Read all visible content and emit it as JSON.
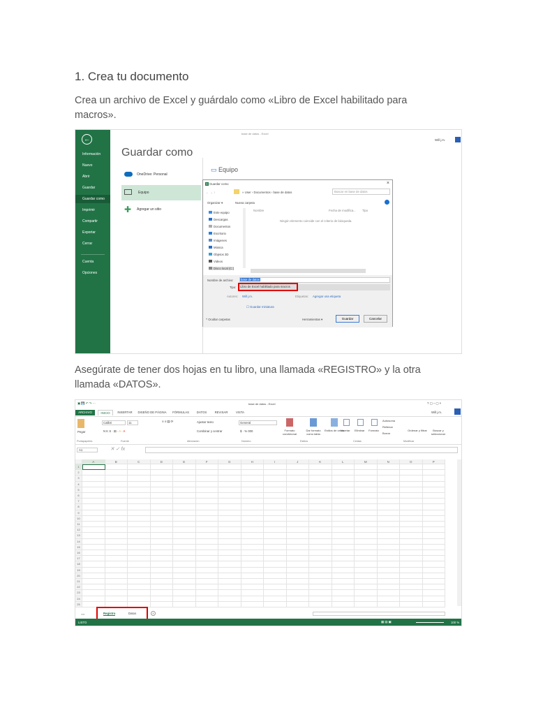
{
  "heading": "1. Crea tu documento",
  "para1": "Crea un archivo de Excel y guárdalo como «Libro de Excel habilitado para macros».",
  "para2": "Asegúrate de tener dos hojas en tu libro, una llamada «REGISTRO» y la otra llamada «DATOS».",
  "shot1": {
    "window_title": "base de datos - Excel",
    "user": "Will j.m.",
    "sidebar": [
      "Información",
      "Nuevo",
      "Abrir",
      "Guardar",
      "Guardar como",
      "Imprimir",
      "Compartir",
      "Exportar",
      "Cerrar",
      "Cuenta",
      "Opciones"
    ],
    "title": "Guardar como",
    "locations": [
      "OneDrive: Personal",
      "Equipo",
      "Agregar un sitio"
    ],
    "section": "Equipo",
    "dialog": {
      "title": "Guardar como",
      "path": [
        "User",
        "Documentos",
        "base de datos"
      ],
      "search_placeholder": "Buscar en base de datos",
      "organize": "Organizar ▾",
      "new_folder": "Nueva carpeta",
      "tree": [
        "Este equipo",
        "Descargas",
        "Documentos",
        "Escritorio",
        "Imágenes",
        "Música",
        "Objetos 3D",
        "Videos",
        "Disco local (C:)"
      ],
      "cols": [
        "Nombre",
        "Fecha de modifica...",
        "Tipo"
      ],
      "empty": "Ningún elemento coincide con el criterio de búsqueda.",
      "filename_label": "Nombre de archivo:",
      "filename": "base de datos",
      "type_label": "Tipo:",
      "type": "Libro de Excel habilitado para macros",
      "authors_label": "Autores:",
      "authors": "Will j.m.",
      "tags_label": "Etiquetas:",
      "tags": "Agregar una etiqueta",
      "thumbnail": "Guardar miniatura",
      "hide": "Ocultar carpetas",
      "tools": "Herramientas ▾",
      "save": "Guardar",
      "cancel": "Cancelar"
    }
  },
  "shot2": {
    "window_title": "base de datos - Excel",
    "user": "Will j.m.",
    "tabs": [
      "ARCHIVO",
      "INICIO",
      "INSERTAR",
      "DISEÑO DE PÁGINA",
      "FÓRMULAS",
      "DATOS",
      "REVISAR",
      "VISTA"
    ],
    "font": "Calibri",
    "size": "11",
    "wrap": "Ajustar texto",
    "merge": "Combinar y centrar",
    "number_format": "General",
    "paste": "Pegar",
    "styles": [
      "Formato condicional",
      "Dar formato como tabla",
      "Estilos de celda"
    ],
    "cells_btns": [
      "Insertar",
      "Eliminar",
      "Formato"
    ],
    "edit": [
      "Autosuma",
      "Rellenar",
      "Borrar",
      "Ordenar y filtrar",
      "Buscar y seleccionar"
    ],
    "groups": [
      "Portapapeles",
      "Fuente",
      "Alineación",
      "Número",
      "Estilos",
      "Celdas",
      "Modificar"
    ],
    "namebox": "A1",
    "fx": "fx",
    "columns": [
      "A",
      "B",
      "C",
      "D",
      "E",
      "F",
      "G",
      "H",
      "I",
      "J",
      "K",
      "L",
      "M",
      "N",
      "O",
      "P"
    ],
    "rows": [
      "1",
      "2",
      "3",
      "4",
      "5",
      "6",
      "7",
      "8",
      "9",
      "10",
      "11",
      "12",
      "13",
      "14",
      "15",
      "16",
      "17",
      "18",
      "19",
      "20",
      "21",
      "22",
      "23",
      "24",
      "25"
    ],
    "sheets": [
      "Registro",
      "Datos"
    ],
    "status": "LISTO",
    "zoom": "100 %",
    "accent": "#217346",
    "highlight": "#e00000"
  }
}
